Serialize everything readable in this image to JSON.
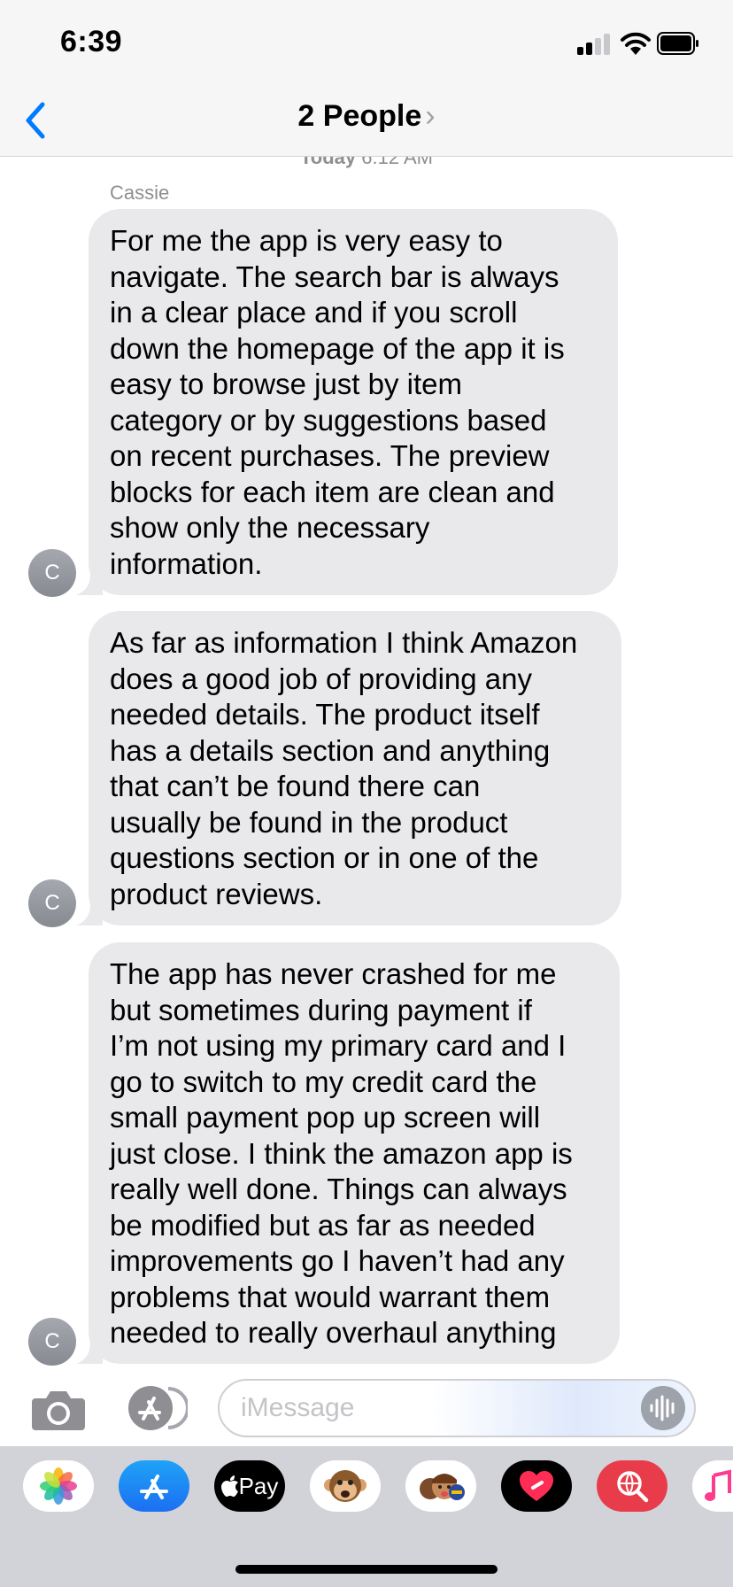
{
  "status_bar": {
    "time": "6:39",
    "signal_icon": "cellular-signal-icon",
    "wifi_icon": "wifi-icon",
    "battery_icon": "battery-icon"
  },
  "nav": {
    "back_icon": "chevron-left-icon",
    "title": "2 People",
    "title_chevron": "›"
  },
  "conversation": {
    "timestamp_day": "Today",
    "timestamp_time": "6:12 AM",
    "sender_name": "Cassie",
    "messages": [
      {
        "avatar_initial": "C",
        "text": "For me the app is very easy to\nnavigate. The search bar is always\nin a clear place and if you scroll\ndown the homepage of the app it is\neasy to browse just by item\ncategory or by suggestions based\non recent purchases. The preview\nblocks for each item are clean and\nshow only the necessary\ninformation."
      },
      {
        "avatar_initial": "C",
        "text": "As far as information I think Amazon\ndoes a good job of providing any\nneeded details. The product itself\nhas a details section and anything\nthat can’t be found there can\nusually be found in the product\nquestions section or in one of the\nproduct reviews."
      },
      {
        "avatar_initial": "C",
        "text": "The app has never crashed for me\nbut sometimes during payment if\nI’m not using my primary card and I\ngo to switch to my credit card the\nsmall payment pop up screen will\njust close. I think the amazon app is\nreally well done. Things can always\nbe modified but as far as needed\nimprovements go I haven’t had any\nproblems that would warrant them\nneeded to really overhaul anything"
      }
    ]
  },
  "compose": {
    "camera_icon": "camera-icon",
    "apps_icon": "app-store-icon",
    "placeholder": "iMessage",
    "audio_icon": "audio-waveform-icon"
  },
  "app_drawer": {
    "apps": [
      {
        "name": "photos-app-icon"
      },
      {
        "name": "app-store-app-icon"
      },
      {
        "name": "apple-pay-app-icon",
        "label": "Pay"
      },
      {
        "name": "animoji-app-icon"
      },
      {
        "name": "memoji-app-icon"
      },
      {
        "name": "digital-touch-app-icon"
      },
      {
        "name": "images-search-app-icon"
      },
      {
        "name": "music-app-icon"
      }
    ]
  },
  "colors": {
    "accent": "#007aff",
    "bubble_gray": "#e9e9eb",
    "bar_gray": "#f6f6f6"
  }
}
